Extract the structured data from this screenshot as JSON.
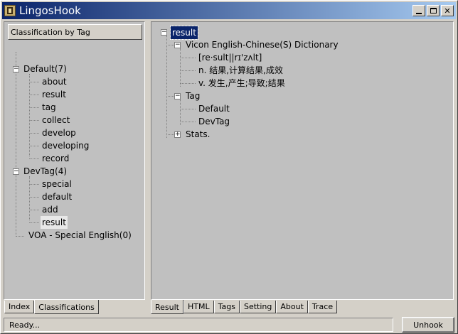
{
  "window": {
    "title": "LingosHook"
  },
  "left": {
    "header": "Classification by Tag",
    "groups": [
      {
        "label": "Default(7)",
        "items": [
          "about",
          "result",
          "tag",
          "collect",
          "develop",
          "developing",
          "record"
        ]
      },
      {
        "label": "DevTag(4)",
        "items": [
          "special",
          "default",
          "add",
          "result"
        ]
      },
      {
        "label": "VOA - Special English(0)",
        "items": []
      }
    ],
    "tabs": [
      "Index",
      "Classifications"
    ]
  },
  "right": {
    "root": "result",
    "dictionary": {
      "label": "Vicon English-Chinese(S) Dictionary",
      "phonetic": "[re·sult||rɪ'zʌlt]",
      "noun": "n. 结果,计算结果,成效",
      "verb": "v. 发生,产生;导致;结果"
    },
    "tag": {
      "label": "Tag",
      "items": [
        "Default",
        "DevTag"
      ]
    },
    "stats": {
      "label": "Stats."
    },
    "tabs": [
      "Result",
      "HTML",
      "Tags",
      "Setting",
      "About",
      "Trace"
    ]
  },
  "status": {
    "text": "Ready...",
    "unhook": "Unhook"
  }
}
